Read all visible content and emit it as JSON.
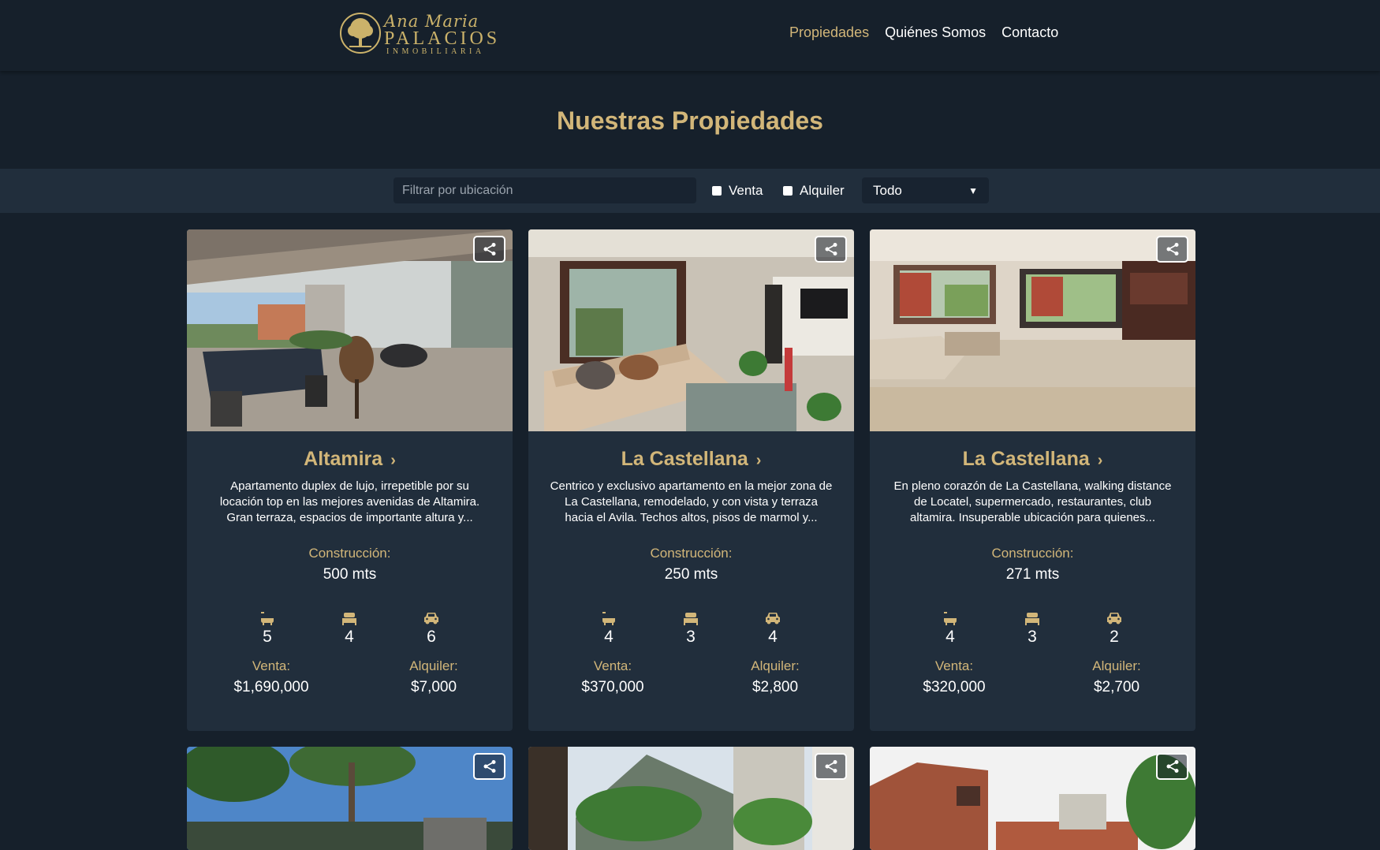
{
  "brand": {
    "script": "Ana Maria",
    "name": "PALACIOS",
    "sub": "INMOBILIARIA",
    "gold": "#d2b679"
  },
  "nav": {
    "items": [
      {
        "label": "Propiedades",
        "active": true
      },
      {
        "label": "Quiénes Somos",
        "active": false
      },
      {
        "label": "Contacto",
        "active": false
      }
    ]
  },
  "page": {
    "title": "Nuestras Propiedades"
  },
  "filters": {
    "location_placeholder": "Filtrar por ubicación",
    "venta_label": "Venta",
    "alquiler_label": "Alquiler",
    "select_value": "Todo"
  },
  "labels": {
    "construccion": "Construcción:",
    "venta": "Venta:",
    "alquiler": "Alquiler:"
  },
  "properties": [
    {
      "title": "Altamira",
      "description": "Apartamento duplex de lujo, irrepetible por su locación top en las mejores avenidas de Altamira. Gran terraza, espacios de importante altura y...",
      "construccion": "500 mts",
      "banos": "5",
      "habitaciones": "4",
      "estacionamientos": "6",
      "venta": "$1,690,000",
      "alquiler": "$7,000"
    },
    {
      "title": "La Castellana",
      "description": "Centrico y exclusivo apartamento en la mejor zona de La Castellana, remodelado, y con vista y terraza hacia el Avila. Techos altos, pisos de marmol y...",
      "construccion": "250 mts",
      "banos": "4",
      "habitaciones": "3",
      "estacionamientos": "4",
      "venta": "$370,000",
      "alquiler": "$2,800"
    },
    {
      "title": "La Castellana",
      "description": "En pleno corazón de La Castellana, walking distance de Locatel, supermercado, restaurantes, club altamira. Insuperable ubicación para quienes...",
      "construccion": "271 mts",
      "banos": "4",
      "habitaciones": "3",
      "estacionamientos": "2",
      "venta": "$320,000",
      "alquiler": "$2,700"
    }
  ]
}
